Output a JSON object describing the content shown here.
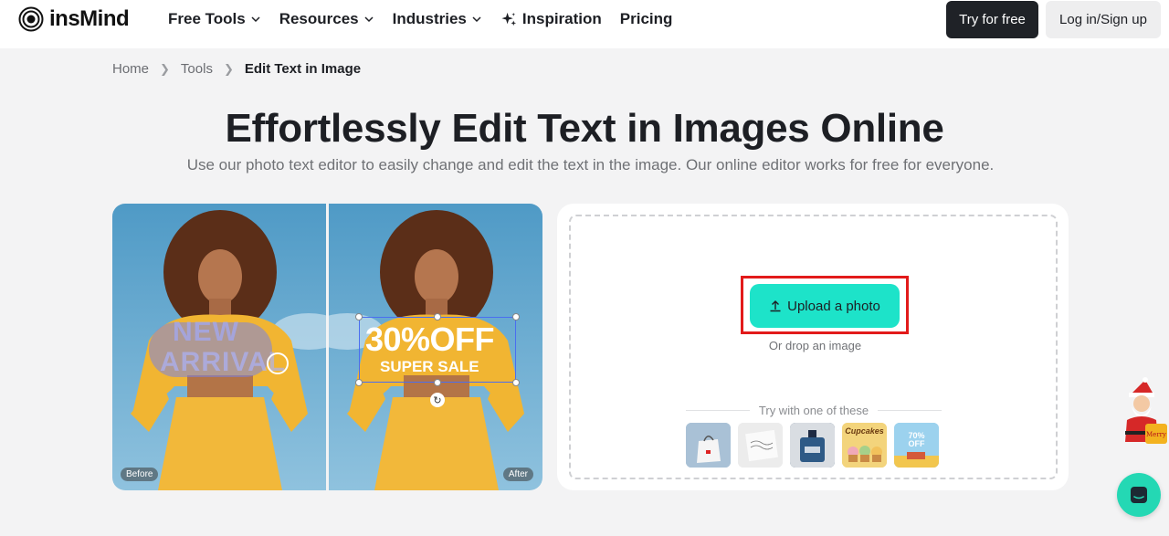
{
  "brand": {
    "name": "insMind"
  },
  "nav": {
    "items": [
      {
        "label": "Free Tools",
        "dropdown": true
      },
      {
        "label": "Resources",
        "dropdown": true
      },
      {
        "label": "Industries",
        "dropdown": true
      },
      {
        "label": "Inspiration",
        "dropdown": false,
        "icon": "sparkle-icon"
      },
      {
        "label": "Pricing",
        "dropdown": false
      }
    ],
    "try_label": "Try for free",
    "login_label": "Log in/Sign up"
  },
  "breadcrumb": {
    "home": "Home",
    "tools": "Tools",
    "current": "Edit Text in Image"
  },
  "hero": {
    "title": "Effortlessly Edit Text in Images Online",
    "subtitle": "Use our photo text editor to easily change and edit the text in the image. Our online editor works for free for everyone."
  },
  "demo": {
    "before_label": "Before",
    "after_label": "After",
    "before_line1": "NEW",
    "before_line2": "ARRIVAL",
    "after_line1": "30%OFF",
    "after_line2": "SUPER SALE"
  },
  "upload": {
    "button_label": "Upload a photo",
    "drop_hint": "Or drop an image",
    "try_label": "Try with one of these",
    "samples": [
      {
        "name": "sample-bag",
        "label": ""
      },
      {
        "name": "sample-card",
        "label": ""
      },
      {
        "name": "sample-perfume",
        "label": ""
      },
      {
        "name": "sample-cupcakes",
        "label": "Cupcakes"
      },
      {
        "name": "sample-sale-poster",
        "label": "70% OFF"
      }
    ]
  },
  "colors": {
    "accent": "#1de3c9",
    "highlight": "#e21a1a",
    "dark_button": "#1f2227"
  }
}
